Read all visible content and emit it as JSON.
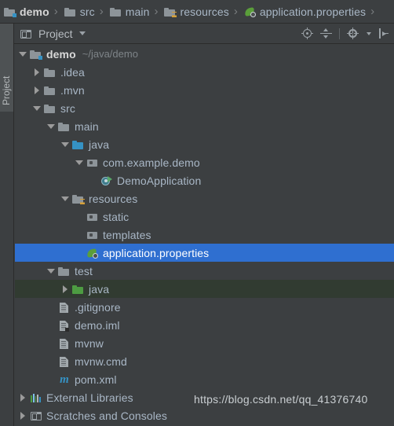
{
  "breadcrumb": {
    "items": [
      {
        "label": "demo",
        "icon": "module-folder-icon",
        "bold": true
      },
      {
        "label": "src",
        "icon": "folder-icon",
        "bold": false
      },
      {
        "label": "main",
        "icon": "folder-icon",
        "bold": false
      },
      {
        "label": "resources",
        "icon": "resources-folder-icon",
        "bold": false
      },
      {
        "label": "application.properties",
        "icon": "spring-properties-icon",
        "bold": false
      }
    ],
    "separator": "›"
  },
  "tool_window": {
    "title": "Project",
    "tab_icon": "project-window-icon",
    "dropdown_icon": "chevron-down-icon",
    "actions": [
      {
        "name": "select-opened-file-button",
        "icon": "locate-target-icon"
      },
      {
        "name": "collapse-all-button",
        "icon": "collapse-all-icon"
      },
      {
        "name": "settings-button",
        "icon": "gear-icon"
      },
      {
        "name": "hide-button",
        "icon": "hide-panel-icon"
      }
    ]
  },
  "left_strip": {
    "tab_label": "Project"
  },
  "tree": {
    "rows": [
      {
        "label": "demo",
        "sublabel": "~/java/demo",
        "indent": 0,
        "arrow": "expanded",
        "icon": "module-folder-icon",
        "bold": true,
        "state": "normal"
      },
      {
        "label": ".idea",
        "sublabel": "",
        "indent": 1,
        "arrow": "collapsed",
        "icon": "folder-icon",
        "bold": false,
        "state": "normal"
      },
      {
        "label": ".mvn",
        "sublabel": "",
        "indent": 1,
        "arrow": "collapsed",
        "icon": "folder-icon",
        "bold": false,
        "state": "normal"
      },
      {
        "label": "src",
        "sublabel": "",
        "indent": 1,
        "arrow": "expanded",
        "icon": "folder-icon",
        "bold": false,
        "state": "normal"
      },
      {
        "label": "main",
        "sublabel": "",
        "indent": 2,
        "arrow": "expanded",
        "icon": "folder-icon",
        "bold": false,
        "state": "normal"
      },
      {
        "label": "java",
        "sublabel": "",
        "indent": 3,
        "arrow": "expanded",
        "icon": "source-root-folder-icon",
        "bold": false,
        "state": "normal"
      },
      {
        "label": "com.example.demo",
        "sublabel": "",
        "indent": 4,
        "arrow": "expanded",
        "icon": "package-icon",
        "bold": false,
        "state": "normal"
      },
      {
        "label": "DemoApplication",
        "sublabel": "",
        "indent": 5,
        "arrow": "none",
        "icon": "spring-boot-class-icon",
        "bold": false,
        "state": "normal"
      },
      {
        "label": "resources",
        "sublabel": "",
        "indent": 3,
        "arrow": "expanded",
        "icon": "resources-folder-icon",
        "bold": false,
        "state": "normal"
      },
      {
        "label": "static",
        "sublabel": "",
        "indent": 4,
        "arrow": "none",
        "icon": "package-icon",
        "bold": false,
        "state": "normal"
      },
      {
        "label": "templates",
        "sublabel": "",
        "indent": 4,
        "arrow": "none",
        "icon": "package-icon",
        "bold": false,
        "state": "normal"
      },
      {
        "label": "application.properties",
        "sublabel": "",
        "indent": 4,
        "arrow": "none",
        "icon": "spring-properties-icon",
        "bold": false,
        "state": "selected"
      },
      {
        "label": "test",
        "sublabel": "",
        "indent": 2,
        "arrow": "expanded",
        "icon": "folder-icon",
        "bold": false,
        "state": "normal"
      },
      {
        "label": "java",
        "sublabel": "",
        "indent": 3,
        "arrow": "collapsed",
        "icon": "test-root-folder-icon",
        "bold": false,
        "state": "test-root"
      },
      {
        "label": ".gitignore",
        "sublabel": "",
        "indent": 2,
        "arrow": "none",
        "icon": "file-icon",
        "bold": false,
        "state": "normal"
      },
      {
        "label": "demo.iml",
        "sublabel": "",
        "indent": 2,
        "arrow": "none",
        "icon": "module-file-icon",
        "bold": false,
        "state": "normal"
      },
      {
        "label": "mvnw",
        "sublabel": "",
        "indent": 2,
        "arrow": "none",
        "icon": "file-icon",
        "bold": false,
        "state": "normal"
      },
      {
        "label": "mvnw.cmd",
        "sublabel": "",
        "indent": 2,
        "arrow": "none",
        "icon": "file-icon",
        "bold": false,
        "state": "normal"
      },
      {
        "label": "pom.xml",
        "sublabel": "",
        "indent": 2,
        "arrow": "none",
        "icon": "maven-icon",
        "bold": false,
        "state": "normal"
      },
      {
        "label": "External Libraries",
        "sublabel": "",
        "indent": 0,
        "arrow": "collapsed",
        "icon": "libraries-icon",
        "bold": false,
        "state": "normal"
      },
      {
        "label": "Scratches and Consoles",
        "sublabel": "",
        "indent": 0,
        "arrow": "collapsed",
        "icon": "scratches-icon",
        "bold": false,
        "state": "normal"
      }
    ]
  },
  "watermark": {
    "text": "https://blog.csdn.net/qq_41376740"
  },
  "colors": {
    "background": "#3c3f41",
    "text": "#a9b7c6",
    "selection": "#2f6fd0",
    "test_root": "#313b31",
    "source_root_folder": "#3592c4",
    "test_root_folder": "#4d9c42",
    "spring_green": "#5a9e3a",
    "maven_blue": "#3592c4"
  }
}
